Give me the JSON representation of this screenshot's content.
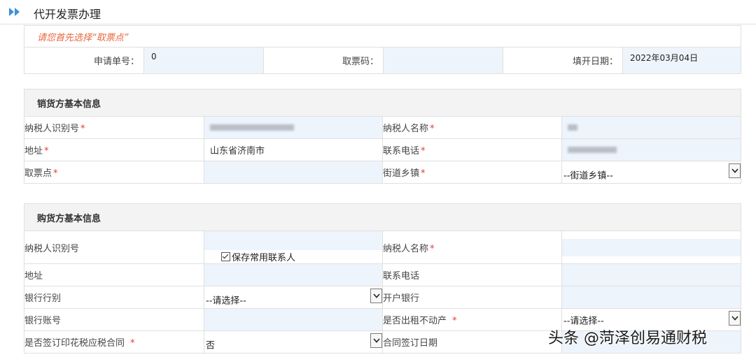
{
  "page": {
    "title": "代开发票办理"
  },
  "notice": "请您首先选择“取票点”",
  "top_fields": {
    "app_no_label": "申请单号：",
    "app_no_value": "0",
    "pickup_code_label": "取票码：",
    "pickup_code_value": "",
    "fill_date_label": "填开日期：",
    "fill_date_value": "2022年03月04日"
  },
  "seller": {
    "header": "销货方基本信息",
    "taxpayer_id_label": "纳税人识别号",
    "taxpayer_name_label": "纳税人名称",
    "address_label": "地址",
    "address_value": "山东省济南市",
    "phone_label": "联系电话",
    "pickup_point_label": "取票点",
    "street_label": "街道乡镇",
    "street_value": "--街道乡镇--"
  },
  "buyer": {
    "header": "购货方基本信息",
    "taxpayer_id_label": "纳税人识别号",
    "save_contact_label": "保存常用联系人",
    "taxpayer_name_label": "纳税人名称",
    "address_label": "地址",
    "phone_label": "联系电话",
    "bank_type_label": "银行行别",
    "bank_type_value": "--请选择--",
    "bank_label": "开户银行",
    "account_label": "银行账号",
    "rent_property_label": "是否出租不动产",
    "rent_property_value": "--请选择--",
    "stamp_contract_label": "是否签订印花税应税合同",
    "stamp_contract_value": "否",
    "contract_date_label": "合同签订日期"
  },
  "required_mark": "*",
  "watermark": "头条 @菏泽创易通财税",
  "colors": {
    "accent": "#3f8fd8",
    "notice": "#e8663d",
    "required": "#e03a3a",
    "input_bg": "#eef4fc",
    "header_bg": "#f3f3f3"
  }
}
